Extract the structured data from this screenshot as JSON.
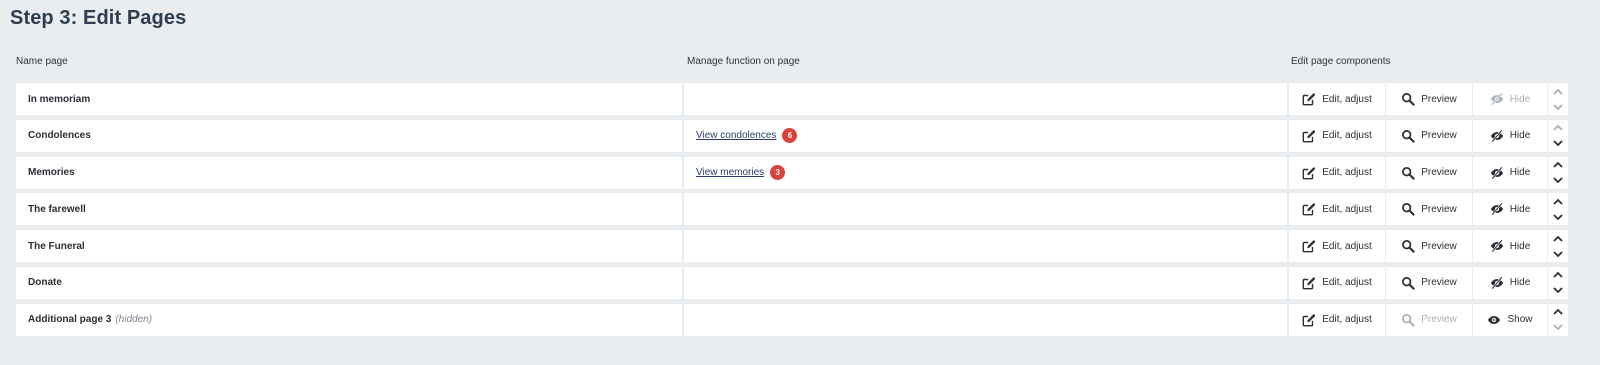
{
  "page": {
    "title": "Step 3: Edit Pages"
  },
  "columns": {
    "name": "Name page",
    "manage": "Manage function on page",
    "edit": "Edit page components"
  },
  "labels": {
    "edit": "Edit, adjust",
    "preview": "Preview",
    "hide": "Hide",
    "show": "Show"
  },
  "rows": [
    {
      "name": "In memoriam",
      "hidden_note": "",
      "link": "",
      "count": "",
      "preview_enabled": true,
      "visibility": "hide",
      "visibility_enabled": false,
      "up_enabled": false,
      "down_enabled": false
    },
    {
      "name": "Condolences",
      "hidden_note": "",
      "link": "View condolences",
      "count": "6",
      "preview_enabled": true,
      "visibility": "hide",
      "visibility_enabled": true,
      "up_enabled": false,
      "down_enabled": true
    },
    {
      "name": "Memories",
      "hidden_note": "",
      "link": "View memories",
      "count": "3",
      "preview_enabled": true,
      "visibility": "hide",
      "visibility_enabled": true,
      "up_enabled": true,
      "down_enabled": true
    },
    {
      "name": "The farewell",
      "hidden_note": "",
      "link": "",
      "count": "",
      "preview_enabled": true,
      "visibility": "hide",
      "visibility_enabled": true,
      "up_enabled": true,
      "down_enabled": true
    },
    {
      "name": "The Funeral",
      "hidden_note": "",
      "link": "",
      "count": "",
      "preview_enabled": true,
      "visibility": "hide",
      "visibility_enabled": true,
      "up_enabled": true,
      "down_enabled": true
    },
    {
      "name": "Donate",
      "hidden_note": "",
      "link": "",
      "count": "",
      "preview_enabled": true,
      "visibility": "hide",
      "visibility_enabled": true,
      "up_enabled": true,
      "down_enabled": true
    },
    {
      "name": "Additional page 3",
      "hidden_note": "(hidden)",
      "link": "",
      "count": "",
      "preview_enabled": false,
      "visibility": "show",
      "visibility_enabled": true,
      "up_enabled": true,
      "down_enabled": false
    }
  ],
  "colors": {
    "background": "#eaedf0",
    "title": "#2d3e4e",
    "link": "#2d3b6b",
    "badge": "#d9423b",
    "disabled": "#a9b0b8"
  },
  "icons": {
    "edit": "pencil-square-icon",
    "preview": "magnifier-icon",
    "hide": "eye-slash-icon",
    "show": "eye-icon",
    "up": "chevron-up-icon",
    "down": "chevron-down-icon"
  }
}
